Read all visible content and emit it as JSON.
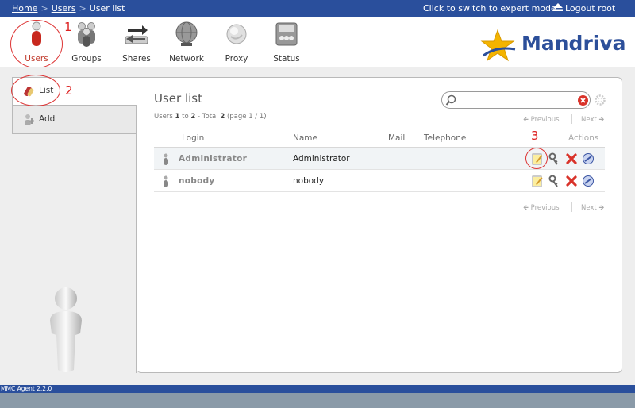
{
  "topbar": {
    "breadcrumb": [
      "Home",
      "Users",
      "User list"
    ],
    "breadcrumb_sep": ">",
    "expert_mode": "Click to switch to expert mode",
    "logout": "Logout root"
  },
  "modules": [
    {
      "label": "Users",
      "icon": "users-icon",
      "active": true
    },
    {
      "label": "Groups",
      "icon": "groups-icon"
    },
    {
      "label": "Shares",
      "icon": "shares-icon"
    },
    {
      "label": "Network",
      "icon": "network-icon"
    },
    {
      "label": "Proxy",
      "icon": "proxy-icon"
    },
    {
      "label": "Status",
      "icon": "status-icon"
    }
  ],
  "annotations": [
    "1",
    "2",
    "3"
  ],
  "logo": {
    "text": "Mandriva"
  },
  "sidebar": {
    "items": [
      {
        "label": "List",
        "icon": "list-icon",
        "active": true
      },
      {
        "label": "Add",
        "icon": "add-user-icon"
      }
    ]
  },
  "main": {
    "title": "User list",
    "summary": {
      "prefix": "Users ",
      "from": "1",
      "to_word": " to ",
      "to": "2",
      "mid": " - Total ",
      "total": "2",
      "suffix": " (page 1 / 1)"
    },
    "search": {
      "value": "",
      "placeholder": ""
    },
    "pager": {
      "previous": "Previous",
      "next": "Next"
    },
    "columns": [
      "Login",
      "Name",
      "Mail",
      "Telephone",
      "Actions"
    ],
    "rows": [
      {
        "login": "Administrator",
        "name": "Administrator",
        "mail": "",
        "telephone": ""
      },
      {
        "login": "nobody",
        "name": "nobody",
        "mail": "",
        "telephone": ""
      }
    ],
    "actions": [
      "edit-icon",
      "acl-key-icon",
      "delete-icon",
      "backup-icon"
    ]
  },
  "footer": {
    "version": "MMC Agent 2.2.0"
  },
  "colors": {
    "topbar": "#2a4f9c",
    "accent": "#c13b2d",
    "annotation": "#dd2222"
  }
}
